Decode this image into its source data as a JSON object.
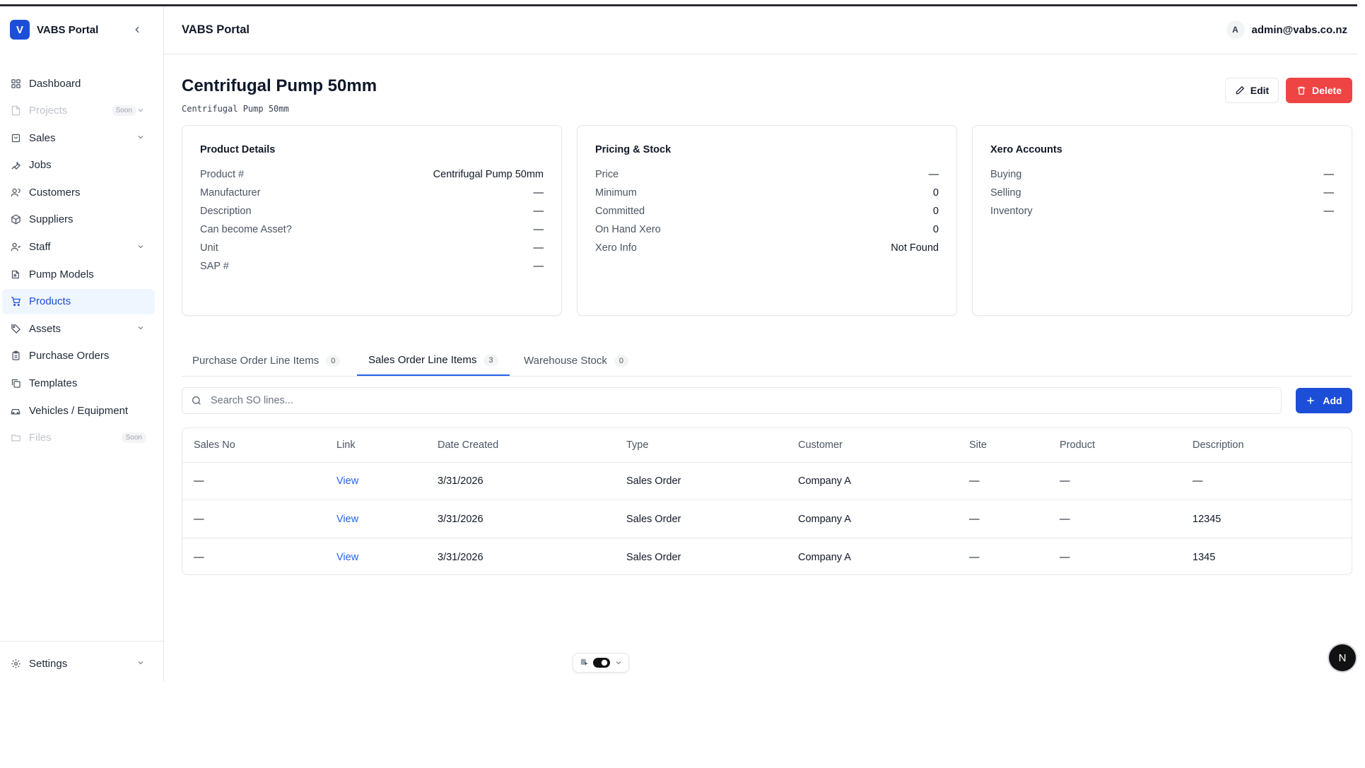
{
  "app": {
    "logo_letter": "V",
    "name": "VABS Portal"
  },
  "sidebar": {
    "items": [
      {
        "label": "Dashboard"
      },
      {
        "label": "Projects",
        "badge": "Soon"
      },
      {
        "label": "Sales"
      },
      {
        "label": "Jobs"
      },
      {
        "label": "Customers"
      },
      {
        "label": "Suppliers"
      },
      {
        "label": "Staff"
      },
      {
        "label": "Pump Models"
      },
      {
        "label": "Products"
      },
      {
        "label": "Assets"
      },
      {
        "label": "Purchase Orders"
      },
      {
        "label": "Templates"
      },
      {
        "label": "Vehicles / Equipment"
      },
      {
        "label": "Files",
        "badge": "Soon"
      }
    ],
    "settings_label": "Settings"
  },
  "header": {
    "title": "VABS Portal",
    "avatar_letter": "A",
    "user_email": "admin@vabs.co.nz"
  },
  "page": {
    "title": "Centrifugal Pump 50mm",
    "subtitle": "Centrifugal Pump 50mm",
    "edit_label": "Edit",
    "delete_label": "Delete"
  },
  "cards": {
    "product_details": {
      "title": "Product Details",
      "rows": [
        {
          "k": "Product #",
          "v": "Centrifugal Pump 50mm"
        },
        {
          "k": "Manufacturer",
          "v": "—"
        },
        {
          "k": "Description",
          "v": "—"
        },
        {
          "k": "Can become Asset?",
          "v": "—"
        },
        {
          "k": "Unit",
          "v": "—"
        },
        {
          "k": "SAP #",
          "v": "—"
        }
      ]
    },
    "pricing_stock": {
      "title": "Pricing & Stock",
      "rows": [
        {
          "k": "Price",
          "v": "—"
        },
        {
          "k": "Minimum",
          "v": "0"
        },
        {
          "k": "Committed",
          "v": "0"
        },
        {
          "k": "On Hand Xero",
          "v": "0"
        },
        {
          "k": "Xero Info",
          "v": "Not Found"
        }
      ]
    },
    "xero_accounts": {
      "title": "Xero Accounts",
      "rows": [
        {
          "k": "Buying",
          "v": "—"
        },
        {
          "k": "Selling",
          "v": "—"
        },
        {
          "k": "Inventory",
          "v": "—"
        }
      ]
    }
  },
  "tabs": [
    {
      "label": "Purchase Order Line Items",
      "count": "0"
    },
    {
      "label": "Sales Order Line Items",
      "count": "3"
    },
    {
      "label": "Warehouse Stock",
      "count": "0"
    }
  ],
  "search": {
    "placeholder": "Search SO lines...",
    "value": ""
  },
  "add_label": "Add",
  "table": {
    "headers": [
      "Sales No",
      "Link",
      "Date Created",
      "Type",
      "Customer",
      "Site",
      "Product",
      "Description"
    ],
    "rows": [
      [
        "—",
        "View",
        "3/31/2026",
        "Sales Order",
        "Company A",
        "—",
        "—",
        "—"
      ],
      [
        "—",
        "View",
        "3/31/2026",
        "Sales Order",
        "Company A",
        "—",
        "—",
        "12345"
      ],
      [
        "—",
        "View",
        "3/31/2026",
        "Sales Order",
        "Company A",
        "—",
        "—",
        "1345"
      ]
    ]
  },
  "floating": {
    "n_badge": "N"
  },
  "colors": {
    "primary": "#1d4ed8",
    "danger": "#ef4444",
    "active_bg": "#eff6ff",
    "link": "#2563eb"
  }
}
